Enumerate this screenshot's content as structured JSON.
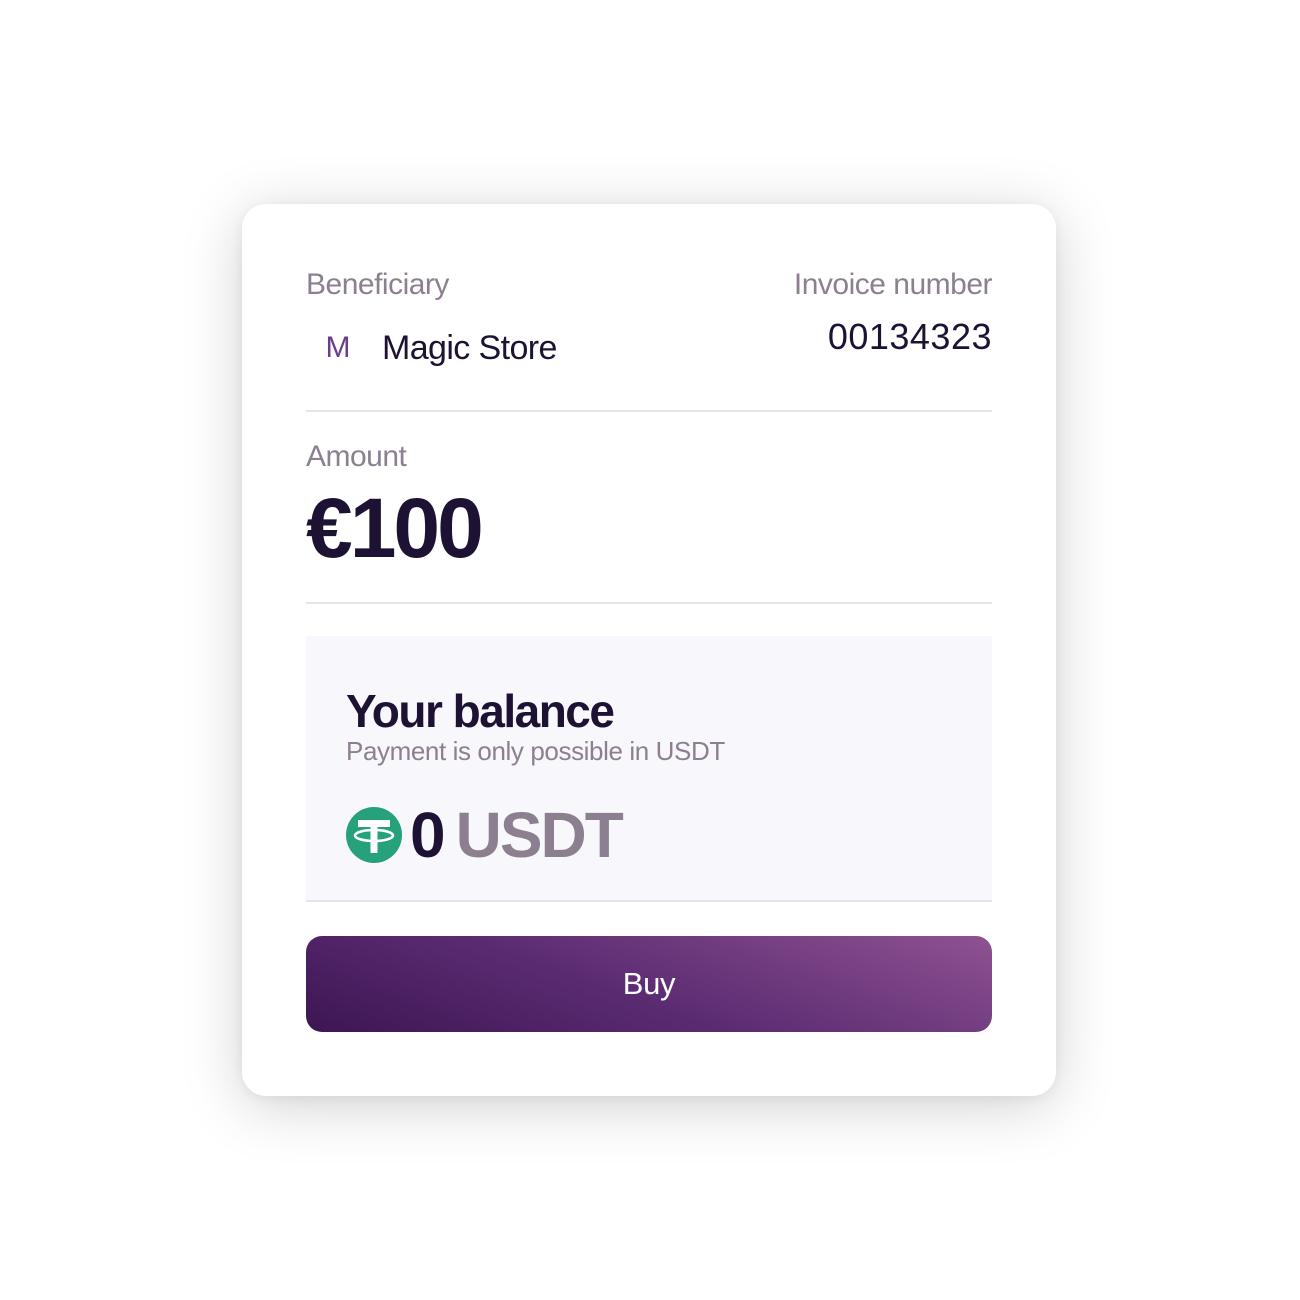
{
  "beneficiary": {
    "label": "Beneficiary",
    "avatar_letter": "M",
    "name": "Magic Store"
  },
  "invoice": {
    "label": "Invoice number",
    "number": "00134323"
  },
  "amount": {
    "label": "Amount",
    "value": "€100"
  },
  "balance": {
    "title": "Your balance",
    "subtitle": "Payment is only possible in USDT",
    "value": "0",
    "currency": "USDT",
    "icon": "usdt-tether-icon",
    "icon_color": "#26a17b"
  },
  "actions": {
    "buy_label": "Buy",
    "buy_gradient": [
      "#3d1653",
      "#8e5290"
    ]
  }
}
